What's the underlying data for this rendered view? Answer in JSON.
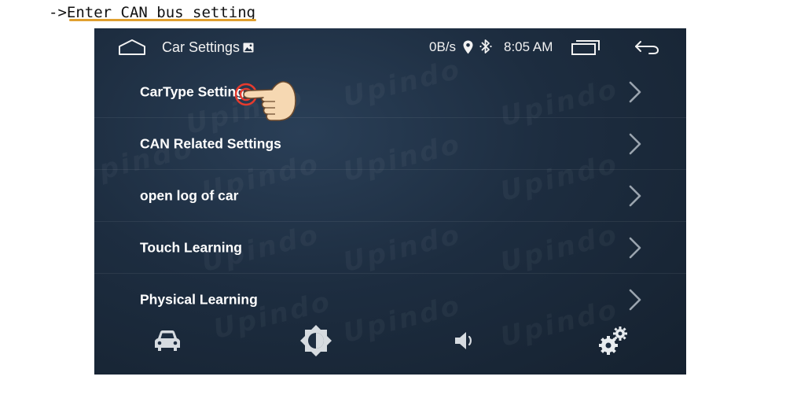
{
  "caption": "->Enter CAN bus setting",
  "header": {
    "title": "Car Settings",
    "net_speed": "0B/s",
    "time": "8:05 AM"
  },
  "watermark": "Upindo",
  "menu": [
    {
      "label": "CarType Setting"
    },
    {
      "label": "CAN Related Settings"
    },
    {
      "label": "open log of car"
    },
    {
      "label": "Touch Learning"
    },
    {
      "label": "Physical Learning"
    }
  ],
  "dock": {
    "icons": [
      "car-icon",
      "brightness-icon",
      "volume-icon",
      "gears-icon"
    ]
  },
  "colors": {
    "background": "#1d2d40",
    "text": "#ffffff",
    "caption_underline": "#e0a030"
  }
}
